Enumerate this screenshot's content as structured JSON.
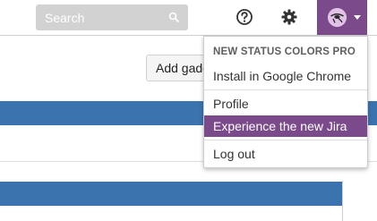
{
  "header": {
    "search_placeholder": "Search",
    "icons": [
      "search-icon",
      "help-icon",
      "gear-icon",
      "avatar",
      "chevron-down-icon"
    ],
    "accent_color": "#7b4a8a"
  },
  "content": {
    "add_gadget_label": "Add gadg",
    "bar_color": "#3b73af"
  },
  "user_menu": {
    "section_heading": "NEW STATUS COLORS PRO",
    "items": [
      {
        "label": "Install in Google Chrome"
      },
      {
        "label": "Profile"
      },
      {
        "label": "Experience the new Jira",
        "active": true
      },
      {
        "label": "Log out"
      }
    ]
  }
}
